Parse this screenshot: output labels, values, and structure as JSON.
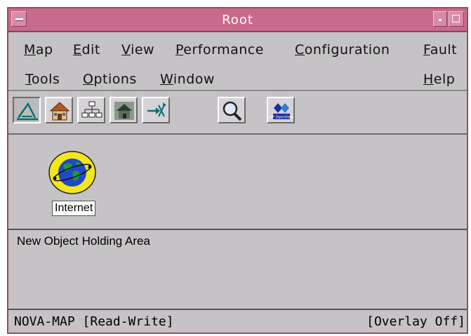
{
  "window": {
    "title": "Root"
  },
  "menubar": {
    "row1": [
      {
        "label": "Map",
        "mnemonic": "M"
      },
      {
        "label": "Edit",
        "mnemonic": "E"
      },
      {
        "label": "View",
        "mnemonic": "V"
      },
      {
        "label": "Performance",
        "mnemonic": "P"
      },
      {
        "label": "Configuration",
        "mnemonic": "C"
      },
      {
        "label": "Fault",
        "mnemonic": "F"
      }
    ],
    "row2": [
      {
        "label": "Tools",
        "mnemonic": "T"
      },
      {
        "label": "Options",
        "mnemonic": "O"
      },
      {
        "label": "Window",
        "mnemonic": "W"
      },
      {
        "label": "Help",
        "mnemonic": "H"
      }
    ]
  },
  "toolbar": {
    "buttons": [
      {
        "icon": "close-submap-icon"
      },
      {
        "icon": "home-submap-icon"
      },
      {
        "icon": "root-submap-icon"
      },
      {
        "icon": "parent-submap-icon"
      },
      {
        "icon": "quick-navigator-icon"
      },
      {
        "icon": "find-icon"
      },
      {
        "icon": "hp-openview-icon",
        "label": "HP OpenView"
      }
    ]
  },
  "map": {
    "objects": [
      {
        "icon": "internet-globe-icon",
        "label": "Internet"
      }
    ]
  },
  "holding_area": {
    "label": "New Object Holding Area"
  },
  "status": {
    "left": "NOVA-MAP [Read-Write]",
    "right": "[Overlay Off]"
  },
  "colors": {
    "title_bar": "#c86a8c",
    "window_bg": "#c6c3c6",
    "globe_ring": "#f3e61c",
    "globe_ocean": "#1f49c7",
    "globe_land": "#1f9a39"
  }
}
